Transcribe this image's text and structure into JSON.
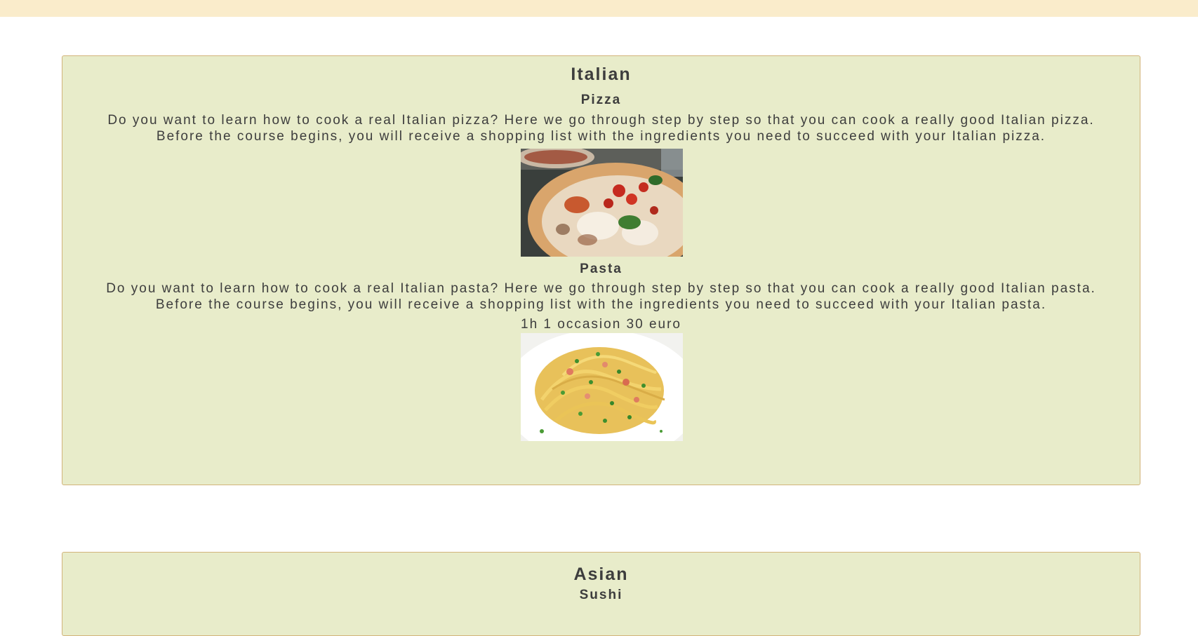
{
  "header": {},
  "sections": [
    {
      "category": "Italian",
      "dishes": [
        {
          "name": "Pizza",
          "description": "Do you want to learn how to cook a real Italian pizza? Here we go through step by step so that you can cook a really good Italian pizza. Before the course begins, you will receive a shopping list with the ingredients you need to succeed with your Italian pizza.",
          "image": "pizza-photo"
        },
        {
          "name": "Pasta",
          "description": "Do you want to learn how to cook a real Italian pasta? Here we go through step by step so that you can cook a really good Italian pasta. Before the course begins, you will receive a shopping list with the ingredients you need to succeed with your Italian pasta.",
          "details": "1h 1 occasion 30 euro",
          "image": "pasta-photo"
        }
      ]
    },
    {
      "category": "Asian",
      "dishes": [
        {
          "name": "Sushi"
        }
      ]
    }
  ],
  "colors": {
    "header_bar": "#faeccb",
    "card_background": "#e8ecca",
    "card_border": "#d2b47a",
    "text": "#3d3d3d"
  }
}
